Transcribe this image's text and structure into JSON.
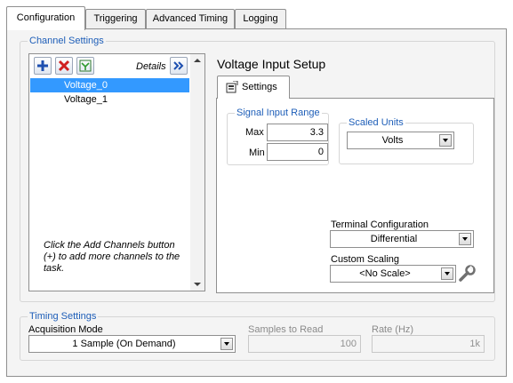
{
  "tabs": [
    {
      "label": "Configuration",
      "active": true
    },
    {
      "label": "Triggering",
      "active": false
    },
    {
      "label": "Advanced Timing",
      "active": false
    },
    {
      "label": "Logging",
      "active": false
    }
  ],
  "channel_settings": {
    "legend": "Channel Settings",
    "details_label": "Details",
    "toolbar_icons": [
      "add-icon",
      "delete-icon",
      "channel-icon",
      "expand-icon"
    ],
    "channels": [
      "Voltage_0",
      "Voltage_1"
    ],
    "selected_channel": "Voltage_0",
    "hint": "Click the Add Channels button (+) to add more channels to the task."
  },
  "voltage_setup": {
    "title": "Voltage Input Setup",
    "settings_tab": "Settings",
    "signal_range": {
      "legend": "Signal Input Range",
      "max_label": "Max",
      "max_value": "3.3",
      "min_label": "Min",
      "min_value": "0"
    },
    "scaled_units": {
      "legend": "Scaled Units",
      "value": "Volts"
    },
    "terminal_config": {
      "label": "Terminal Configuration",
      "value": "Differential"
    },
    "custom_scaling": {
      "label": "Custom Scaling",
      "value": "<No Scale>"
    }
  },
  "timing": {
    "legend": "Timing Settings",
    "acquisition_mode": {
      "label": "Acquisition Mode",
      "value": "1 Sample (On Demand)"
    },
    "samples_to_read": {
      "label": "Samples to Read",
      "value": "100"
    },
    "rate": {
      "label": "Rate (Hz)",
      "value": "1k"
    }
  },
  "colors": {
    "legend_text": "#1e5eb8",
    "selection": "#3399ff",
    "panel_bg": "#f4f4f4"
  }
}
